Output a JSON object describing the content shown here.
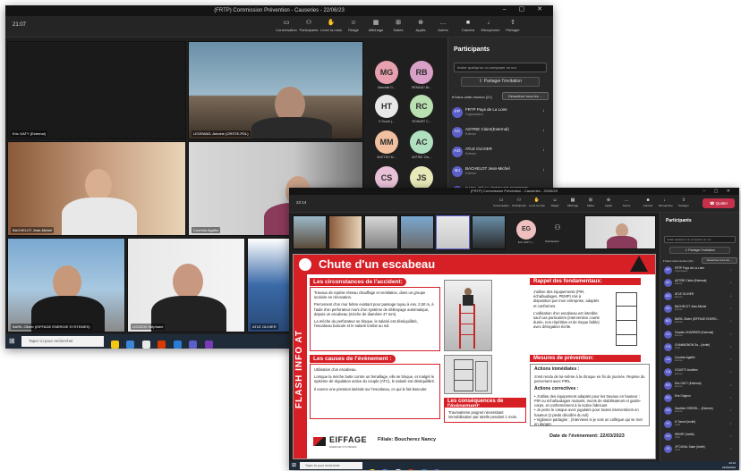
{
  "window1": {
    "title": "(FRTP) Commission Prévention - Causeries - 22/06/23",
    "timer": "21:07",
    "toolbar": [
      {
        "label": "Conversation",
        "icon": "chat-icon"
      },
      {
        "label": "Participants",
        "icon": "people-icon"
      },
      {
        "label": "Lever la main",
        "icon": "hand-icon"
      },
      {
        "label": "Réagir",
        "icon": "smile-icon"
      },
      {
        "label": "Affichage",
        "icon": "layout-icon"
      },
      {
        "label": "Salles",
        "icon": "rooms-icon"
      },
      {
        "label": "Applis",
        "icon": "apps-icon"
      },
      {
        "label": "Autres",
        "icon": "more-icon"
      },
      {
        "label": "Caméra",
        "icon": "camera-icon"
      },
      {
        "label": "Microphone",
        "icon": "mic-icon"
      },
      {
        "label": "Partager",
        "icon": "share-icon"
      }
    ],
    "quit_label": "Quitter",
    "tiles": [
      {
        "name": "Eric GATY (External)"
      },
      {
        "name": "LEGRAND, Antoine (ORSTE-PDL)"
      },
      {
        "name": "BACHELOT Jean-Michel"
      },
      {
        "name": "Courtois Agathe"
      },
      {
        "name": "BARIL Olivier (EIFFAGE ENERGIE SYSTEMES)"
      },
      {
        "name": "LIGOCKI Stéphane"
      },
      {
        "name": "ATLE OLIVIER"
      }
    ],
    "avatars": [
      {
        "initials": "MG",
        "label": "Marcelle G...",
        "color": "#e8a0b0"
      },
      {
        "initials": "RB",
        "label": "RENAUD Br...",
        "color": "#d9a0c8"
      },
      {
        "initials": "HT",
        "label": "H Tourel (...",
        "color": "#e8e8e8"
      },
      {
        "initials": "RC",
        "label": "ROHART C...",
        "color": "#b8e0b0"
      },
      {
        "initials": "MM",
        "label": "MATTEO M...",
        "color": "#f0c0a0"
      },
      {
        "initials": "AC",
        "label": "ASTRIE Cla...",
        "color": "#b0e0c0"
      },
      {
        "initials": "CS",
        "label": "",
        "color": "#e8c0d8"
      },
      {
        "initials": "JS",
        "label": "",
        "color": "#e8e8b8"
      }
    ],
    "panel": {
      "title": "Participants",
      "search_placeholder": "Inviter quelqu'un ou composer un nur",
      "share_label": "Partager l'invitation",
      "section": "Dans cette réunion (21)",
      "mute_all": "Désactiver tous les ...",
      "participants": [
        {
          "initials": "FP",
          "name": "FRTP Pays de La Loire",
          "role": "Organisateur"
        },
        {
          "initials": "AC",
          "name": "ASTRIE Claire(External)",
          "role": "Externe"
        },
        {
          "initials": "AO",
          "name": "ATLE OLIVIER",
          "role": "Externe"
        },
        {
          "initials": "BJ",
          "name": "BACHELOT Jean-Michel",
          "role": "Externe"
        },
        {
          "initials": "BO",
          "name": "BARIL Olivier (EIFFAGE ENERGIE...",
          "role": "Externe"
        },
        {
          "initials": "CC",
          "name": "Charles CHARRIER (External)",
          "role": ""
        }
      ]
    },
    "taskbar": {
      "search": "Taper ici pour rechercher"
    }
  },
  "window2": {
    "title": "(FRTP) Commission Prévention - Causeries - 22/06/23",
    "timer": "22:14",
    "quit_label": "Quitter",
    "self_initials": "EG",
    "self_label": "Eric GATY (...",
    "participants_tile": "Participants",
    "panel": {
      "title": "Participants",
      "search_placeholder": "Inviter quelqu'un ou composer un nur",
      "share_label": "Partager l'invitation",
      "section": "Dans cette réunion (21)",
      "mute_all": "Désactiver tous les ...",
      "participants": [
        {
          "initials": "FP",
          "name": "FRTP Pays de La Loire",
          "role": "Organisateur"
        },
        {
          "initials": "AC",
          "name": "ASTRIE Claire (External)",
          "role": "Externe"
        },
        {
          "initials": "AO",
          "name": "ATLE OLIVIER",
          "role": "Externe"
        },
        {
          "initials": "BJ",
          "name": "BACHELOT Jean-Michel",
          "role": "Externe"
        },
        {
          "initials": "BO",
          "name": "BARIL Olivier (EIFFAGE ENERG...",
          "role": "Externe"
        },
        {
          "initials": "CC",
          "name": "Charles CHARRIER (External)",
          "role": "Externe"
        },
        {
          "initials": "CS",
          "name": "CHAMAGNON Sa... (Invité)",
          "role": "Invité"
        },
        {
          "initials": "CA",
          "name": "Courtois Agathe",
          "role": "Externe"
        },
        {
          "initials": "CA",
          "name": "COUSTY Aurelien",
          "role": "Externe"
        },
        {
          "initials": "EG",
          "name": "Eric GATY (External)",
          "role": "Externe"
        },
        {
          "initials": "EG",
          "name": "Eve Grignon",
          "role": ""
        },
        {
          "initials": "GG",
          "name": "Gauthier GRESSL... (Externe)",
          "role": "Externe"
        },
        {
          "initials": "HT",
          "name": "H Tonnel (Invité)",
          "role": "Invité"
        },
        {
          "initials": "HJ",
          "name": "HENRY (Invité)",
          "role": "Invité"
        },
        {
          "initials": "JD",
          "name": "JF DUVAL Sade (Invité)",
          "role": "Invité"
        }
      ]
    },
    "slide": {
      "title": "Chute d'un escabeau",
      "side_text": "FLASH INFO AT",
      "circ_title": "Les circonstances de l'accident:",
      "circ_p1": "Travaux de reprise réseau chauffage et ventilation, dans un groupe scolaire en rénovation.",
      "circ_p2": "Percement d'un mur béton existant pour passage tuyau à env. 2,50 m, à l'aide d'un perforateur muni d'un système de débrayage automatique, depuis un escabeau (mèche de diamètre 47 mm).",
      "circ_p3": "La mèche du perforateur se bloque, le salarié est déséquilibré, l'escabeau bascule et le salarié tombe au sol.",
      "causes_title": "Les causes de l'évènement :",
      "causes_p1": "Utilisation d'un escabeau.",
      "causes_p2": "Lorsque la mèche butte contre un ferraillage, elle se bloque, et malgré le système de régulation active du couple (ATC), le salarié est déséquilibré.",
      "causes_p3": "Il exerce une pression latérale sur l'escabeau, ce qui le fait basculer.",
      "consq_title": "Les conséquences de l'évènement:",
      "consq_text": "Traumatisme poignet nécessitant immobilisation par attelle pendant 1 mois.",
      "fund_title": "Rappel des fondamentaux:",
      "fund_p1": "J'utilise des équipements (PIR, échafaudages, PEMP) mis à disposition par mon entreprise, adaptés et conformes.",
      "fund_p2": "L'utilisation d'un escabeau est interdite sauf cas particuliers (intervention courte durée, non répétitive et de risque faible) avec dérogation écrite.",
      "measures_title": "Mesures de prévention:",
      "imm_title": "Actions immédiates :",
      "imm_text": "S'est rendu de lui-même à la clinique en fin de journée. Reprise du percement avec PIRL.",
      "corr_title": "Actions correctives :",
      "corr_items": [
        "J'utilise des équipement adaptés pour les travaux en hauteur : PIR ou échafaudages roulants, munis de stabilisateurs et garde-corps, et conformément à la notice fabricant",
        "Je porte le casque avec jugulaire pour toutes interventions en hauteur (2 pieds décollés du sol)",
        "Vigilance partagée : j'interviens si je vois un collègue qui se met en danger."
      ],
      "filiale": "Filiale: Boucherez Nancy",
      "date": "Date de l'évènement: 22/03/2023",
      "brand": "EIFFAGE",
      "brand_sub": "ÉNERGIE SYSTÈMES"
    },
    "taskbar": {
      "search": "Taper ici pour rechercher",
      "time": "22:14",
      "date": "22/06/2023"
    }
  }
}
